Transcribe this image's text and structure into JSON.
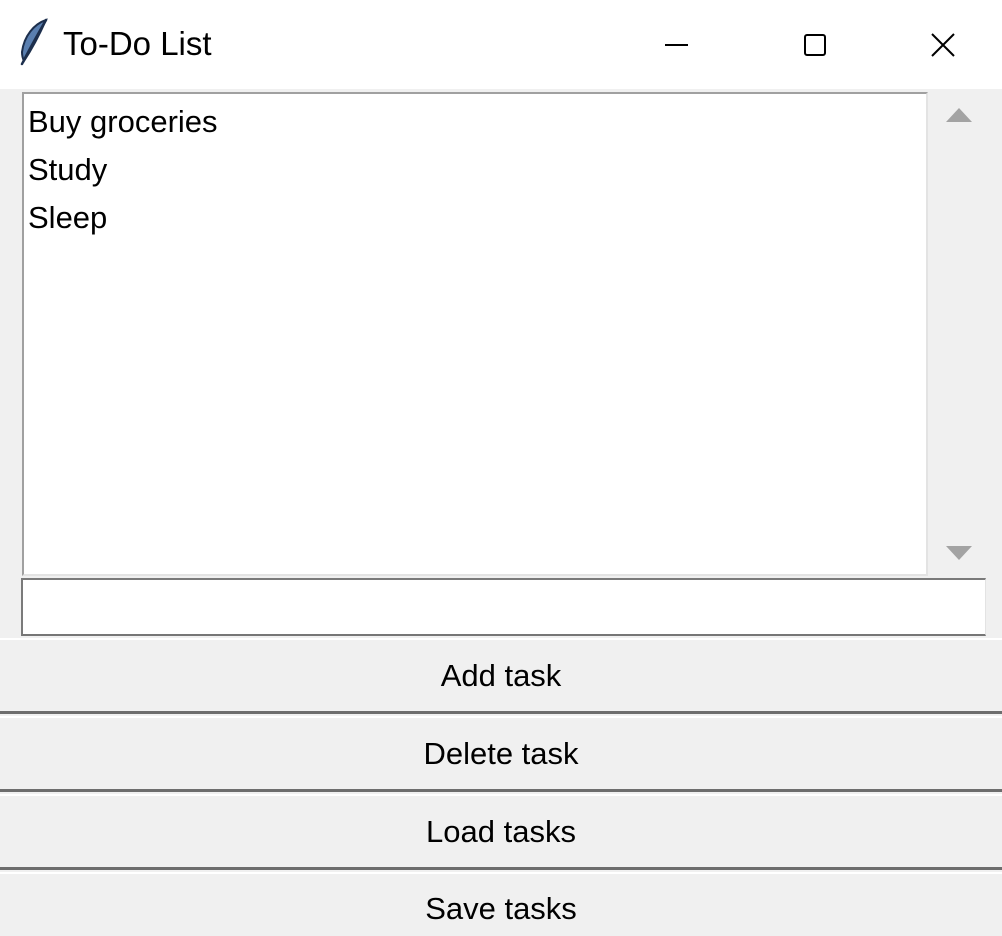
{
  "window": {
    "title": "To-Do List",
    "icon": "feather-icon",
    "controls": {
      "minimize": "minimize-icon",
      "maximize": "maximize-icon",
      "close": "close-icon"
    }
  },
  "tasks": {
    "items": [
      "Buy groceries",
      "Study",
      "Sleep"
    ]
  },
  "entry": {
    "value": ""
  },
  "buttons": {
    "add": "Add task",
    "delete": "Delete task",
    "load": "Load tasks",
    "save": "Save tasks"
  },
  "colors": {
    "background": "#f0f0f0",
    "titlebar": "#ffffff",
    "listbox": "#ffffff",
    "text": "#000000"
  }
}
